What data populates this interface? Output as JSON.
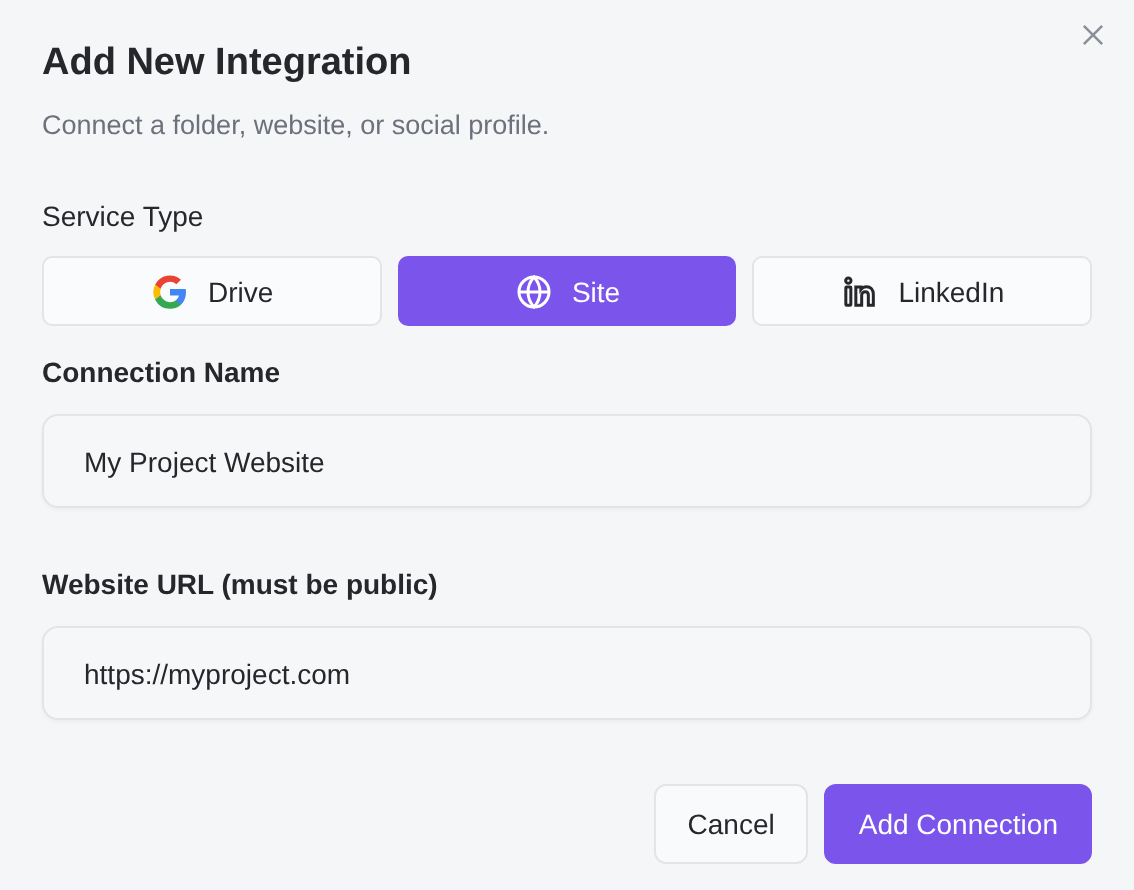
{
  "dialog": {
    "title": "Add New Integration",
    "subtitle": "Connect a folder, website, or social profile."
  },
  "service_type": {
    "label": "Service Type",
    "options": [
      {
        "label": "Drive",
        "kind": "google",
        "selected": false
      },
      {
        "label": "Site",
        "kind": "globe",
        "selected": true
      },
      {
        "label": "LinkedIn",
        "kind": "linkedin",
        "selected": false
      }
    ]
  },
  "fields": [
    {
      "label": "Connection Name",
      "value": "My Project Website"
    },
    {
      "label": "Website URL (must be public)",
      "value": "https://myproject.com"
    }
  ],
  "buttons": [
    {
      "label": "Cancel",
      "kind": "secondary"
    },
    {
      "label": "Add Connection",
      "kind": "primary"
    }
  ]
}
